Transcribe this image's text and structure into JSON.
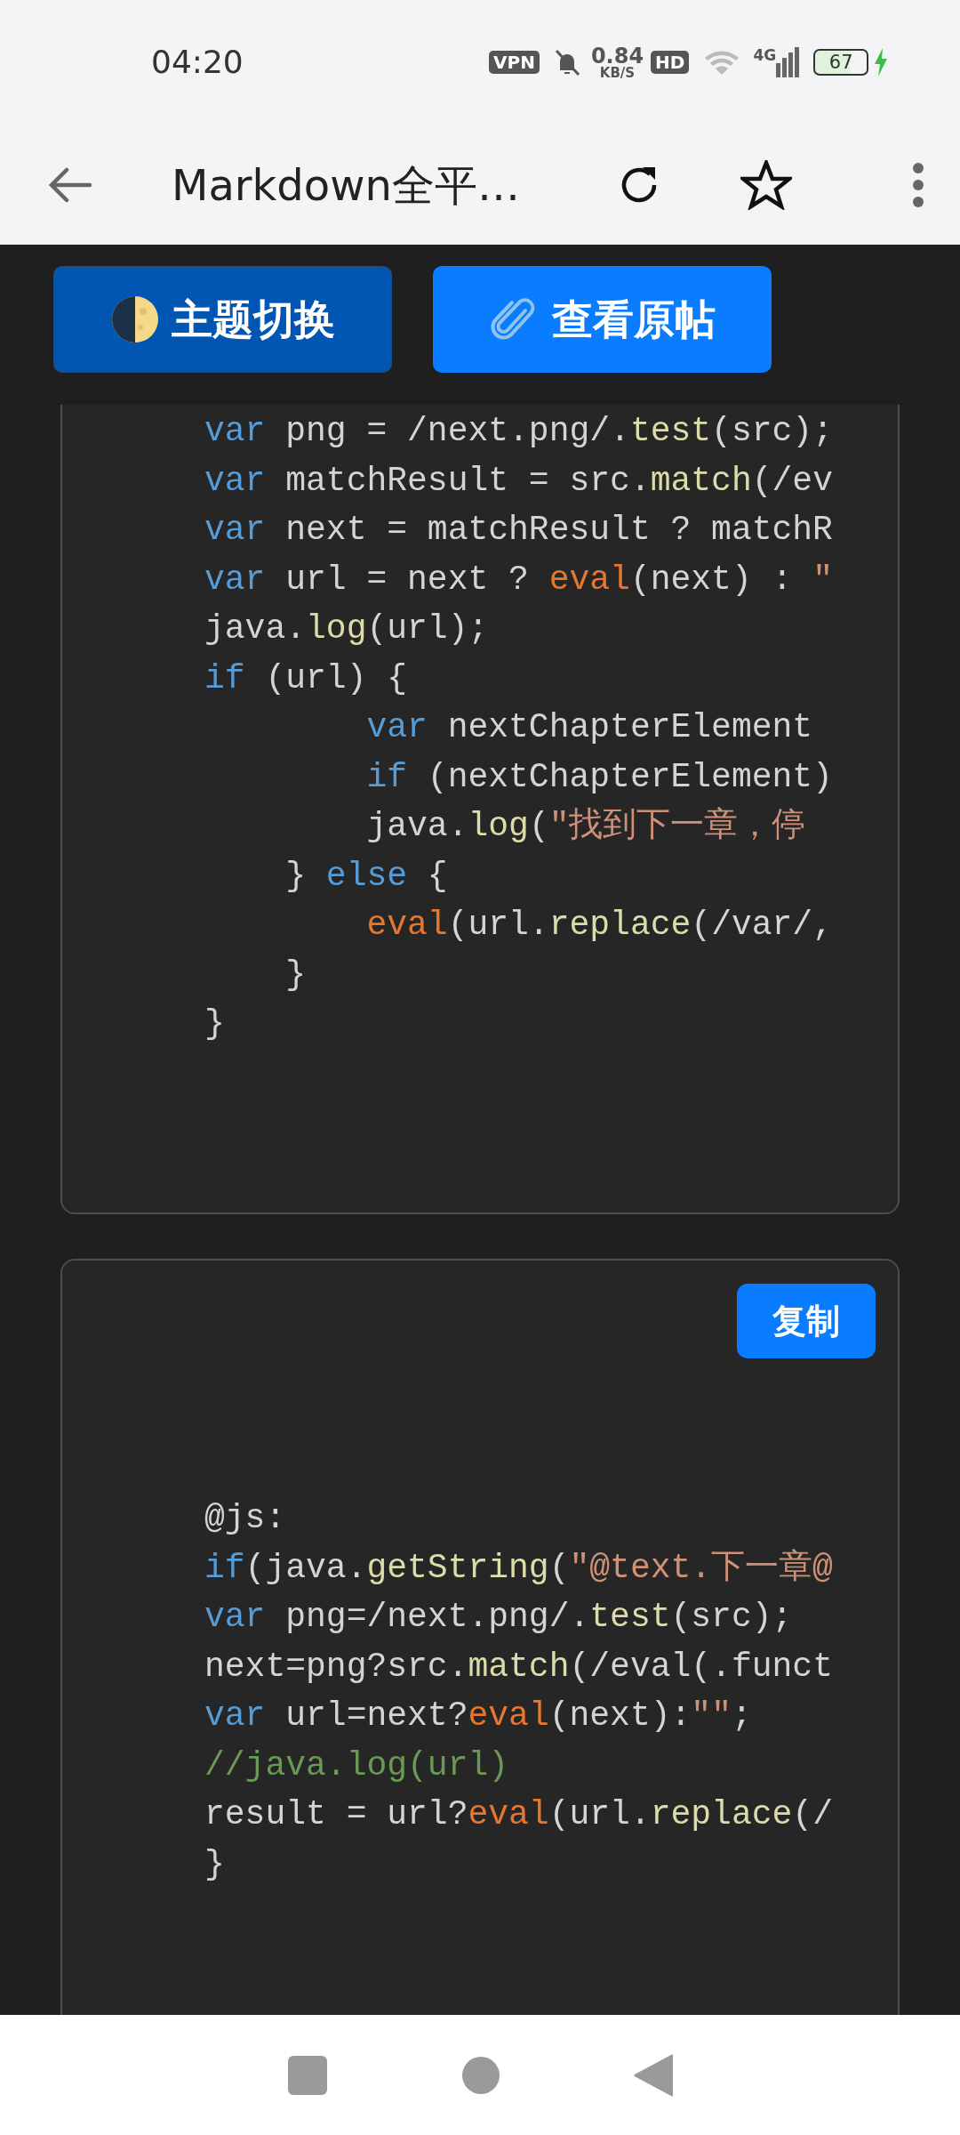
{
  "status_bar": {
    "time": "04:20",
    "vpn": "VPN",
    "speed": "0.84",
    "speed_unit": "KB/S",
    "hd": "HD",
    "network": "4G",
    "battery": "67",
    "charging": true
  },
  "header": {
    "title": "Markdown全平…"
  },
  "toolbar": [
    {
      "label": "主题切换",
      "kind": "theme"
    },
    {
      "label": "查看原帖",
      "kind": "link"
    }
  ],
  "code_blocks": [
    {
      "lines": [
        {
          "tokens": [
            {
              "kind": "keyword",
              "text": "var"
            },
            {
              "kind": "plain",
              "text": " png = /next.png/."
            },
            {
              "kind": "function",
              "text": "test"
            },
            {
              "kind": "plain",
              "text": "(src);"
            }
          ]
        },
        {
          "tokens": [
            {
              "kind": "keyword",
              "text": "var"
            },
            {
              "kind": "plain",
              "text": " matchResult = src."
            },
            {
              "kind": "function",
              "text": "match"
            },
            {
              "kind": "plain",
              "text": "(/ev"
            }
          ]
        },
        {
          "tokens": [
            {
              "kind": "keyword",
              "text": "var"
            },
            {
              "kind": "plain",
              "text": " next = matchResult ? matchR"
            }
          ]
        },
        {
          "tokens": [
            {
              "kind": "keyword",
              "text": "var"
            },
            {
              "kind": "plain",
              "text": " url = next ? "
            },
            {
              "kind": "builtin",
              "text": "eval"
            },
            {
              "kind": "plain",
              "text": "(next) : "
            },
            {
              "kind": "string",
              "text": "\""
            }
          ]
        },
        {
          "tokens": [
            {
              "kind": "plain",
              "text": "java."
            },
            {
              "kind": "function",
              "text": "log"
            },
            {
              "kind": "plain",
              "text": "(url);"
            }
          ]
        },
        {
          "tokens": [
            {
              "kind": "keyword",
              "text": "if"
            },
            {
              "kind": "plain",
              "text": " (url) {"
            }
          ]
        },
        {
          "tokens": [
            {
              "kind": "keyword",
              "text": "        var"
            },
            {
              "kind": "plain",
              "text": " nextChapterElement"
            }
          ]
        },
        {
          "tokens": [
            {
              "kind": "keyword",
              "text": "        if"
            },
            {
              "kind": "plain",
              "text": " (nextChapterElement)"
            }
          ]
        },
        {
          "tokens": [
            {
              "kind": "plain",
              "text": "        java."
            },
            {
              "kind": "function",
              "text": "log"
            },
            {
              "kind": "plain",
              "text": "("
            },
            {
              "kind": "string",
              "text": "\"找到下一章，停"
            }
          ]
        },
        {
          "tokens": [
            {
              "kind": "plain",
              "text": "    } "
            },
            {
              "kind": "keyword",
              "text": "else"
            },
            {
              "kind": "plain",
              "text": " {"
            }
          ]
        },
        {
          "tokens": [
            {
              "kind": "builtin",
              "text": "        eval"
            },
            {
              "kind": "plain",
              "text": "(url."
            },
            {
              "kind": "function",
              "text": "replace"
            },
            {
              "kind": "plain",
              "text": "(/var/,"
            }
          ]
        },
        {
          "tokens": [
            {
              "kind": "plain",
              "text": "    }"
            }
          ]
        },
        {
          "tokens": [
            {
              "kind": "plain",
              "text": "}"
            }
          ]
        }
      ]
    },
    {
      "copy_label": "复制",
      "lines": [
        {
          "tokens": [
            {
              "kind": "plain",
              "text": "@js:"
            }
          ]
        },
        {
          "tokens": [
            {
              "kind": "keyword",
              "text": "if"
            },
            {
              "kind": "plain",
              "text": "(java."
            },
            {
              "kind": "function",
              "text": "getString"
            },
            {
              "kind": "plain",
              "text": "("
            },
            {
              "kind": "string",
              "text": "\"@text.下一章@"
            }
          ]
        },
        {
          "tokens": [
            {
              "kind": "keyword",
              "text": "var"
            },
            {
              "kind": "plain",
              "text": " png=/next.png/."
            },
            {
              "kind": "function",
              "text": "test"
            },
            {
              "kind": "plain",
              "text": "(src);"
            }
          ]
        },
        {
          "tokens": [
            {
              "kind": "plain",
              "text": "next=png?src."
            },
            {
              "kind": "function",
              "text": "match"
            },
            {
              "kind": "plain",
              "text": "(/eval(.funct"
            }
          ]
        },
        {
          "tokens": [
            {
              "kind": "keyword",
              "text": "var"
            },
            {
              "kind": "plain",
              "text": " url=next?"
            },
            {
              "kind": "builtin",
              "text": "eval"
            },
            {
              "kind": "plain",
              "text": "(next):"
            },
            {
              "kind": "string",
              "text": "\"\""
            },
            {
              "kind": "plain",
              "text": ";"
            }
          ]
        },
        {
          "tokens": [
            {
              "kind": "comment",
              "text": "//java.log(url)"
            }
          ]
        },
        {
          "tokens": [
            {
              "kind": "plain",
              "text": "result = url?"
            },
            {
              "kind": "builtin",
              "text": "eval"
            },
            {
              "kind": "plain",
              "text": "(url."
            },
            {
              "kind": "function",
              "text": "replace"
            },
            {
              "kind": "plain",
              "text": "(/"
            }
          ]
        },
        {
          "tokens": [
            {
              "kind": "plain",
              "text": "}"
            }
          ]
        }
      ]
    }
  ]
}
